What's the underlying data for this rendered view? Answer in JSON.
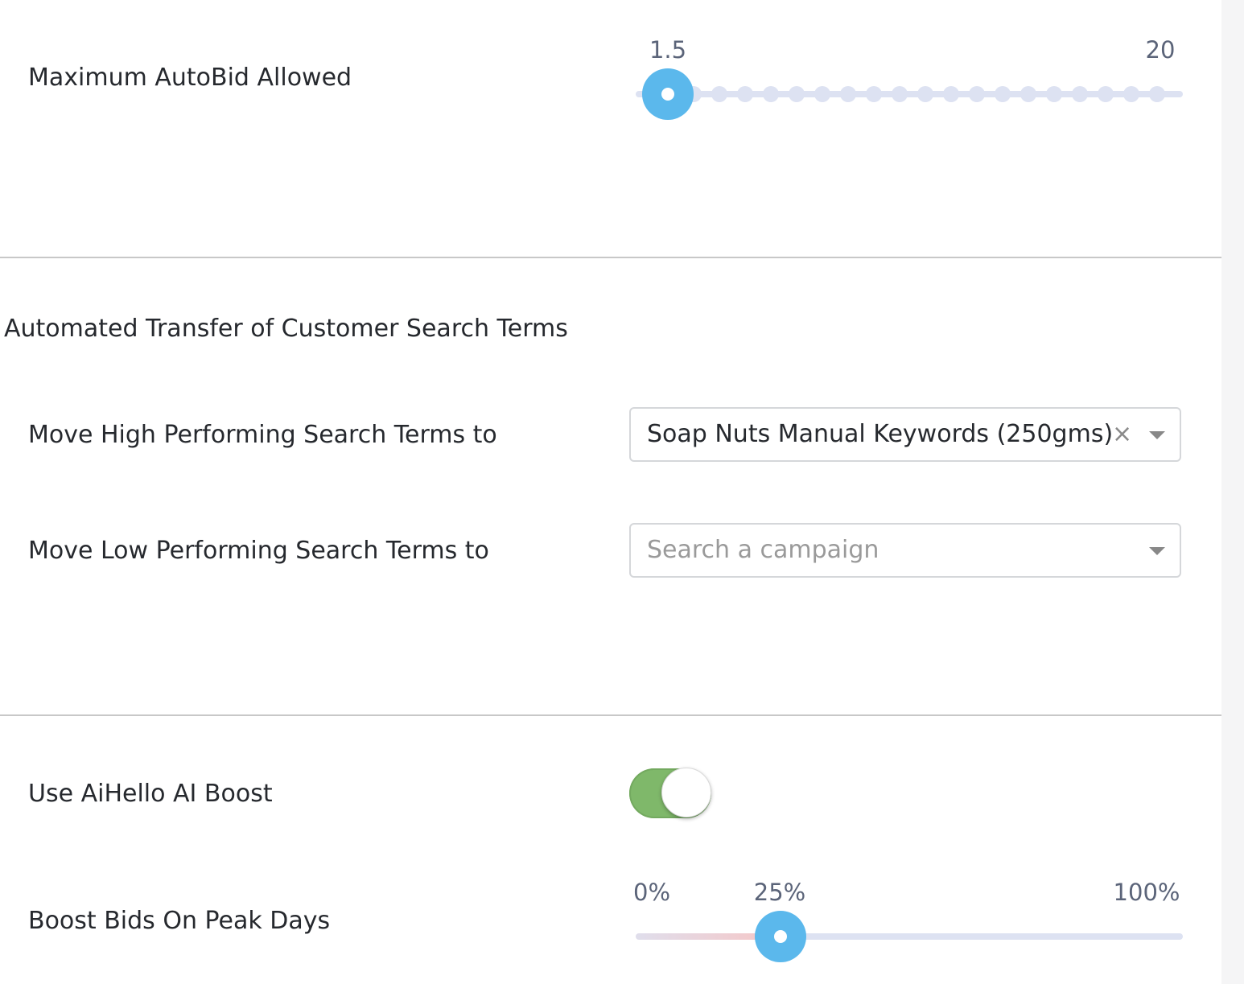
{
  "settings": {
    "max_autobid": {
      "label": "Maximum AutoBid Allowed",
      "min_label": "1.5",
      "max_label": "20",
      "value": 1.5,
      "steps": 20,
      "accent": "#5bb8ec"
    },
    "search_terms_section": {
      "title": "Automated Transfer of Customer Search Terms",
      "high": {
        "label": "Move High Performing Search Terms to",
        "value": "Soap Nuts Manual Keywords (250gms)",
        "clear_symbol": "×"
      },
      "low": {
        "label": "Move Low Performing Search Terms to",
        "placeholder": "Search a campaign"
      }
    },
    "ai_boost": {
      "label": "Use AiHello AI Boost",
      "enabled": true,
      "color": "#7fb86a"
    },
    "peak_boost": {
      "label": "Boost Bids On Peak Days",
      "min_label": "0%",
      "value_label": "25%",
      "max_label": "100%",
      "value_fraction": 0.25
    }
  }
}
